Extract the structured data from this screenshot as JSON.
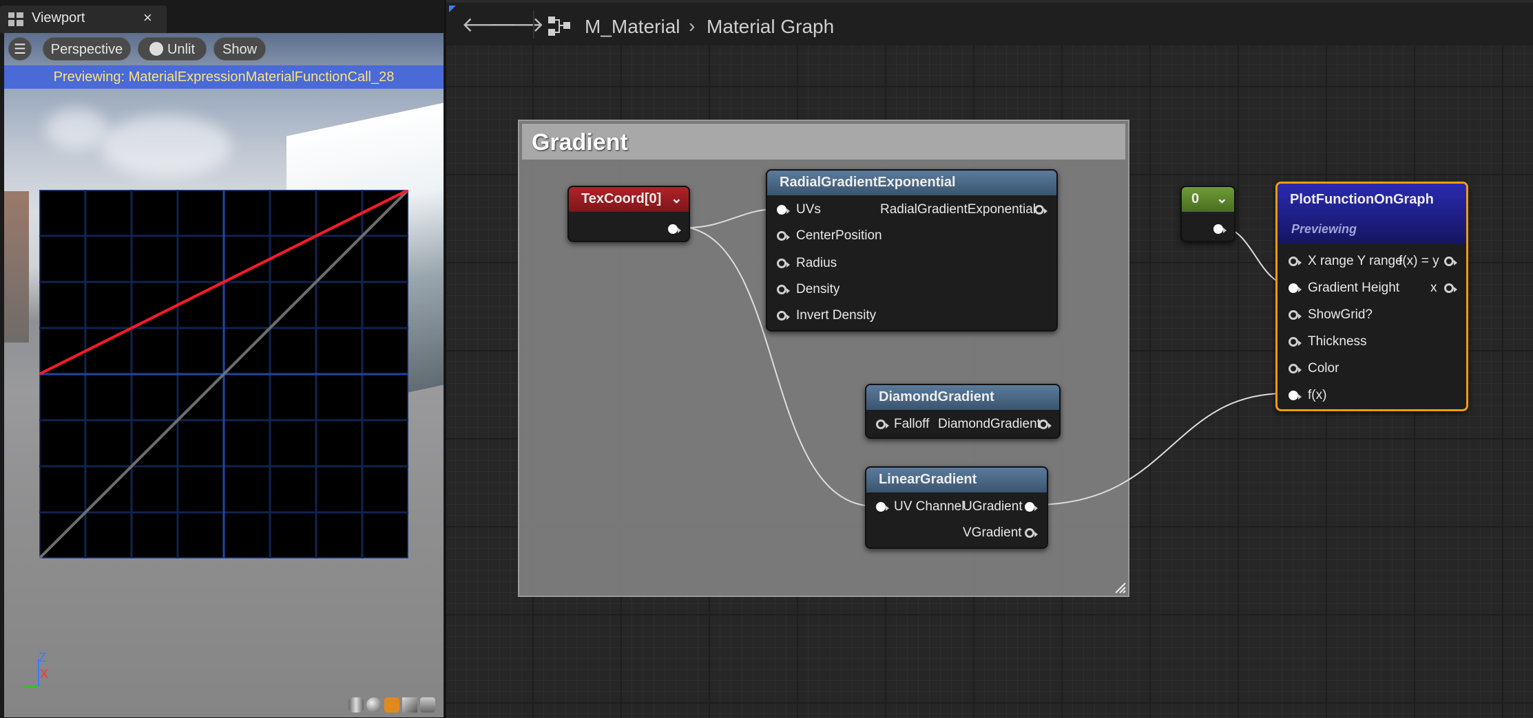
{
  "viewport": {
    "tab_title": "Viewport",
    "tab_close": "×",
    "toolbar": {
      "menu_icon": "hamburger-menu-icon",
      "perspective_label": "Perspective",
      "unlit_label": "Unlit",
      "show_label": "Show"
    },
    "preview_banner": "Previewing: MaterialExpressionMaterialFunctionCall_28",
    "axis": {
      "z": "Z",
      "x": "X"
    },
    "plot": {
      "grid": true,
      "red_line": {
        "from": [
          0,
          0.5
        ],
        "to": [
          1,
          1
        ]
      },
      "gray_line": {
        "from": [
          0,
          0
        ],
        "to": [
          1,
          1
        ]
      }
    },
    "preview_shapes": [
      "cylinder-icon",
      "sphere-icon",
      "plane-icon",
      "cube-icon",
      "teapot-icon"
    ]
  },
  "graph": {
    "nav": {
      "back": "back-arrow-icon",
      "forward": "forward-arrow-icon"
    },
    "breadcrumb": {
      "asset": "M_Material",
      "separator": "›",
      "graph": "Material Graph"
    },
    "comment": {
      "title": "Gradient"
    },
    "nodes": {
      "texcoord": {
        "title": "TexCoord[0]",
        "color": "#9b1d21"
      },
      "radial": {
        "title": "RadialGradientExponential",
        "inputs": [
          "UVs",
          "CenterPosition",
          "Radius",
          "Density",
          "Invert Density"
        ],
        "output": "RadialGradientExponential"
      },
      "diamond": {
        "title": "DiamondGradient",
        "input": "Falloff",
        "output": "DiamondGradient"
      },
      "linear": {
        "title": "LinearGradient",
        "input": "UV Channel",
        "outputs": [
          "UGradient",
          "VGradient"
        ]
      },
      "constant": {
        "title": "0",
        "color": "#5f8b2d"
      },
      "plot": {
        "title": "PlotFunctionOnGraph",
        "status": "Previewing",
        "inputs": [
          "X range Y range",
          "Gradient Height",
          "ShowGrid?",
          "Thickness",
          "Color",
          "f(x)"
        ],
        "outputs": [
          "f(x) = y",
          "x"
        ],
        "border_color": "#f39c12"
      }
    }
  }
}
